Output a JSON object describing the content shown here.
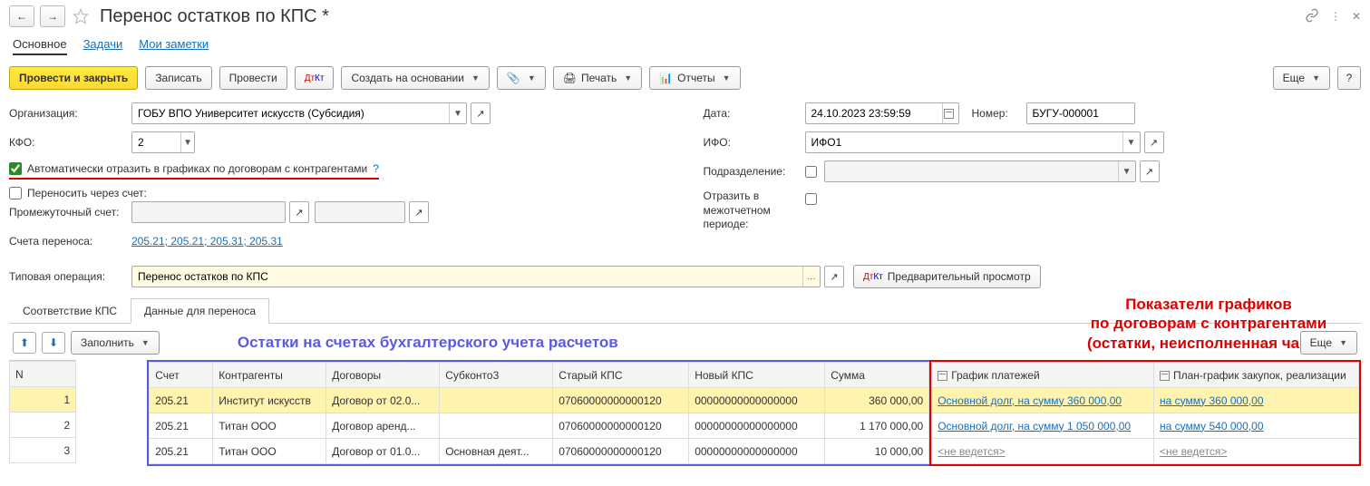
{
  "header": {
    "title": "Перенос остатков по КПС *"
  },
  "subnav": {
    "main": "Основное",
    "tasks": "Задачи",
    "notes": "Мои заметки"
  },
  "toolbar": {
    "post_close": "Провести и закрыть",
    "save": "Записать",
    "post": "Провести",
    "create_based": "Создать на основании",
    "print": "Печать",
    "reports": "Отчеты",
    "more": "Еще"
  },
  "labels": {
    "org": "Организация:",
    "kfo": "КФО:",
    "auto_graph": "Автоматически отразить в графиках по договорам с контрагентами",
    "transfer_acc": "Переносить через счет:",
    "interim_acc": "Промежуточный счет:",
    "transfer_accounts": "Счета переноса:",
    "typ_op": "Типовая операция:",
    "date": "Дата:",
    "ifo": "ИФО:",
    "subdiv": "Подразделение:",
    "interperiod": "Отразить в межотчетном периоде:",
    "number": "Номер:",
    "preview": "Предварительный просмотр",
    "fill": "Заполнить"
  },
  "values": {
    "org": "ГОБУ ВПО Университет искусств (Субсидия)",
    "kfo": "2",
    "date": "24.10.2023 23:59:59",
    "ifo": "ИФО1",
    "number": "БУГУ-000001",
    "accounts_link": "205.21; 205.21; 205.31; 205.31",
    "typ_op": "Перенос остатков по КПС"
  },
  "tabs": {
    "t1": "Соответствие КПС",
    "t2": "Данные для переноса"
  },
  "annotations": {
    "blue": "Остатки на счетах бухгалтерского учета расчетов",
    "red_l1": "Показатели графиков",
    "red_l2": "по договорам с контрагентами",
    "red_l3": "(остатки, неисполненная часть)"
  },
  "table": {
    "columns": {
      "n": "N",
      "account": "Счет",
      "contr": "Контрагенты",
      "dog": "Договоры",
      "sub3": "Субконто3",
      "old_kps": "Старый КПС",
      "new_kps": "Новый КПС",
      "sum": "Сумма",
      "graph_pay": "График платежей",
      "plan_graph": "План-график закупок, реализации"
    },
    "rows": [
      {
        "n": "1",
        "account": "205.21",
        "contr": "Институт искусств",
        "dog": "Договор от 02.0...",
        "sub3": "",
        "old": "07060000000000120",
        "new": "00000000000000000",
        "sum": "360 000,00",
        "gp": "Основной долг, на сумму 360 000,00",
        "pg": "на сумму 360 000,00",
        "gp_class": "link-cell",
        "pg_class": "link-cell"
      },
      {
        "n": "2",
        "account": "205.21",
        "contr": "Титан ООО",
        "dog": "Договор аренд...",
        "sub3": "",
        "old": "07060000000000120",
        "new": "00000000000000000",
        "sum": "1 170 000,00",
        "gp": "Основной долг, на сумму 1 050 000,00",
        "pg": "на сумму 540 000,00",
        "gp_class": "link-cell",
        "pg_class": "link-cell"
      },
      {
        "n": "3",
        "account": "205.21",
        "contr": "Титан ООО",
        "dog": "Договор от 01.0...",
        "sub3": "Основная деят...",
        "old": "07060000000000120",
        "new": "00000000000000000",
        "sum": "10 000,00",
        "gp": "<не ведется>",
        "pg": "<не ведется>",
        "gp_class": "gray",
        "pg_class": "gray"
      }
    ]
  }
}
